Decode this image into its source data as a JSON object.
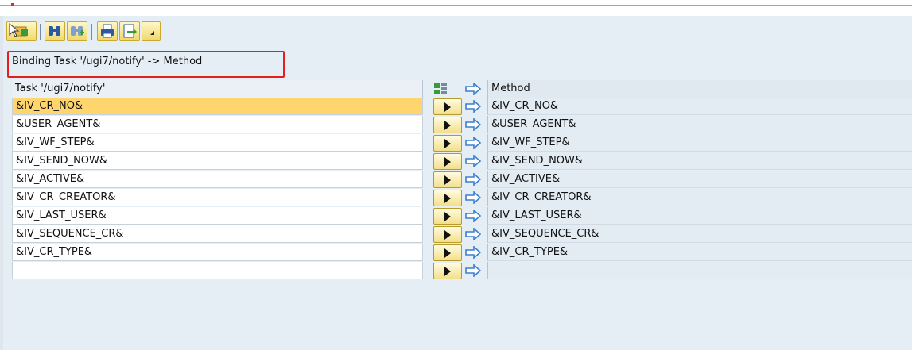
{
  "window": {
    "binding_title": "Binding Task '/ugi7/notify' -> Method"
  },
  "toolbar": {
    "items": [
      {
        "icon": "change-icon"
      },
      {
        "icon": "find-icon"
      },
      {
        "icon": "find-next-icon"
      },
      {
        "icon": "print-icon"
      },
      {
        "icon": "export-icon"
      },
      {
        "icon": "dropdown-icon"
      }
    ]
  },
  "table": {
    "header_task": "Task '/ugi7/notify'",
    "header_method": "Method",
    "rows": [
      {
        "task": "&IV_CR_NO&",
        "method": "&IV_CR_NO&",
        "selected": true
      },
      {
        "task": "&USER_AGENT&",
        "method": "&USER_AGENT&"
      },
      {
        "task": "&IV_WF_STEP&",
        "method": "&IV_WF_STEP&"
      },
      {
        "task": "&IV_SEND_NOW&",
        "method": "&IV_SEND_NOW&"
      },
      {
        "task": "&IV_ACTIVE&",
        "method": "&IV_ACTIVE&"
      },
      {
        "task": "&IV_CR_CREATOR&",
        "method": "&IV_CR_CREATOR&"
      },
      {
        "task": "&IV_LAST_USER&",
        "method": "&IV_LAST_USER&"
      },
      {
        "task": "&IV_SEQUENCE_CR&",
        "method": "&IV_SEQUENCE_CR&"
      },
      {
        "task": "&IV_CR_TYPE&",
        "method": "&IV_CR_TYPE&"
      },
      {
        "task": "",
        "method": ""
      }
    ]
  },
  "colors": {
    "selected_row": "#ffd66e",
    "highlight_box": "#e32020",
    "button_yellow": "#f1d869",
    "arrow_blue": "#3b7fd0"
  }
}
